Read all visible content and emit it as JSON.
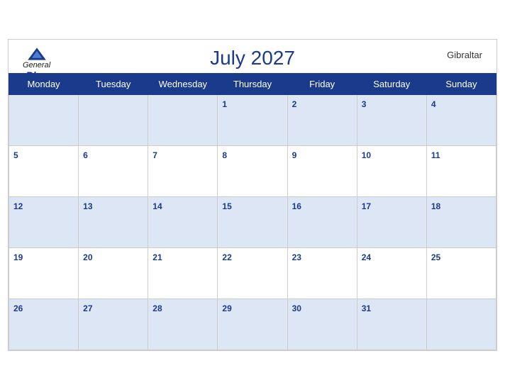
{
  "header": {
    "title": "July 2027",
    "location": "Gibraltar",
    "logo_general": "General",
    "logo_blue": "Blue"
  },
  "weekdays": [
    "Monday",
    "Tuesday",
    "Wednesday",
    "Thursday",
    "Friday",
    "Saturday",
    "Sunday"
  ],
  "weeks": [
    [
      null,
      null,
      null,
      1,
      2,
      3,
      4
    ],
    [
      5,
      6,
      7,
      8,
      9,
      10,
      11
    ],
    [
      12,
      13,
      14,
      15,
      16,
      17,
      18
    ],
    [
      19,
      20,
      21,
      22,
      23,
      24,
      25
    ],
    [
      26,
      27,
      28,
      29,
      30,
      31,
      null
    ]
  ]
}
